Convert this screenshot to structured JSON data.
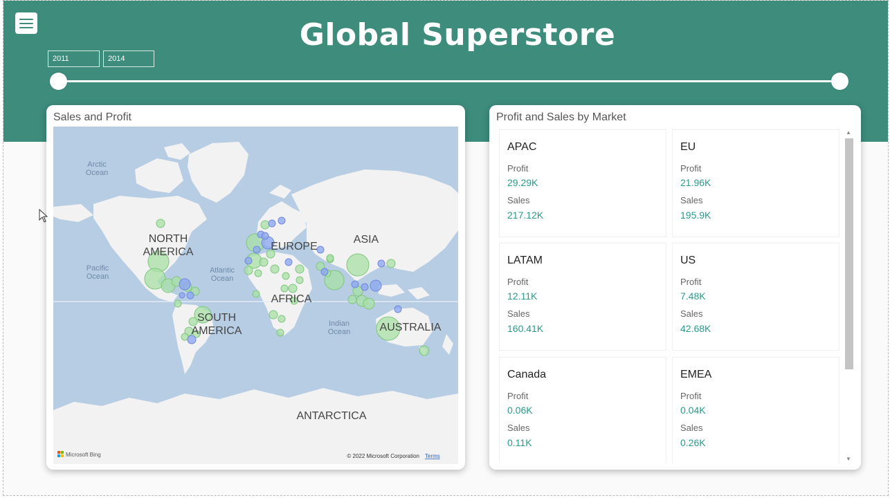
{
  "header": {
    "title": "Global Superstore",
    "menu_icon": "hamburger-menu-icon",
    "date_range": {
      "start": "2011",
      "end": "2014",
      "start_fraction": 0,
      "end_fraction": 1
    }
  },
  "map_card": {
    "title": "Sales and Profit",
    "labels": {
      "arctic_ocean": [
        "Arctic",
        "Ocean"
      ],
      "pacific_ocean": [
        "Pacific",
        "Ocean"
      ],
      "atlantic_ocean": [
        "Atlantic",
        "Ocean"
      ],
      "indian_ocean": [
        "Indian",
        "Ocean"
      ],
      "north_america": [
        "NORTH",
        "AMERICA"
      ],
      "south_america": [
        "SOUTH",
        "AMERICA"
      ],
      "europe": "EUROPE",
      "asia": "ASIA",
      "africa": "AFRICA",
      "australia": "AUSTRALIA",
      "antarctica": "ANTARCTICA"
    },
    "bing_logo": "Microsoft Bing",
    "copyright": "© 2022 Microsoft Corporation",
    "terms_link": "Terms",
    "colors": {
      "ocean": "#b6cde3",
      "land": "#f2f2f2",
      "bubble_green": "#a8e0a6",
      "bubble_blue": "#8fa7ef"
    }
  },
  "market_card": {
    "title": "Profit and Sales by Market",
    "markets": [
      {
        "name": "APAC",
        "profit_label": "Profit",
        "profit": "29.29K",
        "sales_label": "Sales",
        "sales": "217.12K"
      },
      {
        "name": "EU",
        "profit_label": "Profit",
        "profit": "21.96K",
        "sales_label": "Sales",
        "sales": "195.9K"
      },
      {
        "name": "LATAM",
        "profit_label": "Profit",
        "profit": "12.11K",
        "sales_label": "Sales",
        "sales": "160.41K"
      },
      {
        "name": "US",
        "profit_label": "Profit",
        "profit": "7.48K",
        "sales_label": "Sales",
        "sales": "42.68K"
      },
      {
        "name": "Canada",
        "profit_label": "Profit",
        "profit": "0.06K",
        "sales_label": "Sales",
        "sales": "0.11K"
      },
      {
        "name": "EMEA",
        "profit_label": "Profit",
        "profit": "0.04K",
        "sales_label": "Sales",
        "sales": "0.26K"
      }
    ],
    "colors": {
      "value": "#2b9a8c"
    }
  },
  "theme": {
    "header_color": "#3d8c7c"
  }
}
